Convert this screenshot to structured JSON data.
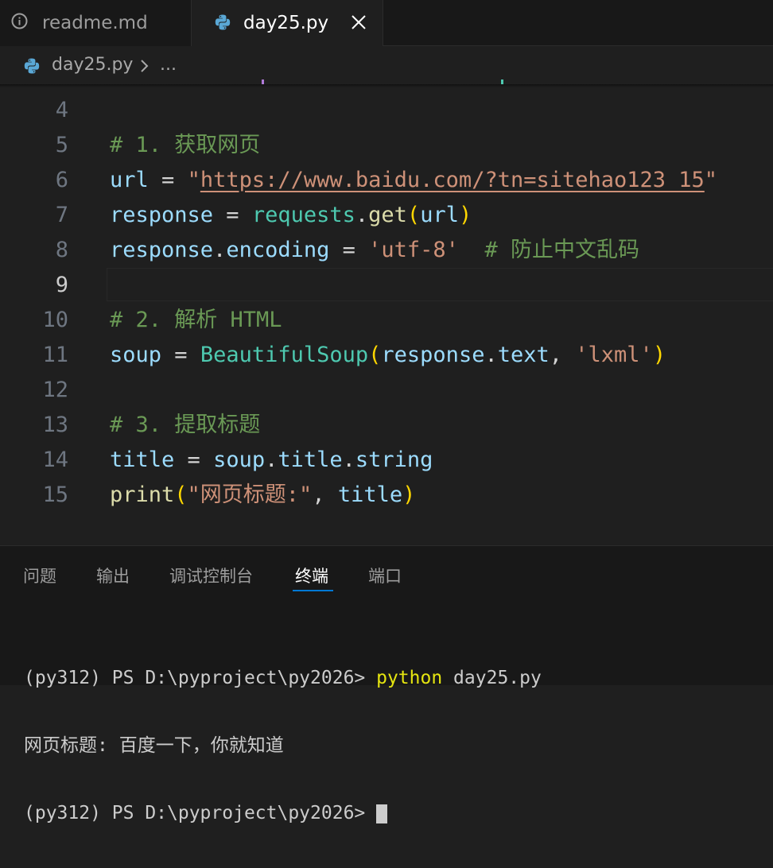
{
  "tabs": [
    {
      "label": "readme.md",
      "icon": "info-icon",
      "active": false
    },
    {
      "label": "day25.py",
      "icon": "python-icon",
      "active": true
    }
  ],
  "breadcrumb": {
    "file": "day25.py",
    "ellipsis": "..."
  },
  "editor": {
    "current_line": 9,
    "lines": [
      {
        "num": "4",
        "text": ""
      },
      {
        "num": "5",
        "comment": "# 1. 获取网页"
      },
      {
        "num": "6",
        "var": "url",
        "op": " = ",
        "q1": "\"",
        "url": "https://www.baidu.com/?tn=sitehao123_15",
        "q2": "\""
      },
      {
        "num": "7",
        "var": "response",
        "op": " = ",
        "mod": "requests",
        "dot": ".",
        "fn": "get",
        "open": "(",
        "arg": "url",
        "close": ")"
      },
      {
        "num": "8",
        "var": "response",
        "dot": ".",
        "attr": "encoding",
        "op": " = ",
        "str": "'utf-8'",
        "comment": "  # 防止中文乱码"
      },
      {
        "num": "9",
        "text": ""
      },
      {
        "num": "10",
        "comment": "# 2. 解析 HTML"
      },
      {
        "num": "11",
        "var": "soup",
        "op": " = ",
        "cls": "BeautifulSoup",
        "open": "(",
        "arg": "response",
        "dot": ".",
        "attr": "text",
        "sep": ", ",
        "str": "'lxml'",
        "close": ")"
      },
      {
        "num": "12",
        "text": ""
      },
      {
        "num": "13",
        "comment": "# 3. 提取标题"
      },
      {
        "num": "14",
        "var": "title",
        "op": " = ",
        "obj": "soup",
        "dot1": ".",
        "attr1": "title",
        "dot2": ".",
        "attr2": "string"
      },
      {
        "num": "15",
        "fn": "print",
        "open": "(",
        "str": "\"网页标题:\"",
        "sep": ", ",
        "arg": "title",
        "close": ")"
      }
    ]
  },
  "panel": {
    "tabs": [
      "问题",
      "输出",
      "调试控制台",
      "终端",
      "端口"
    ],
    "active_tab": "终端"
  },
  "terminal": {
    "prompt": "(py312) PS D:\\pyproject\\py2026> ",
    "command": "python",
    "command_arg": " day25.py",
    "output": "网页标题: 百度一下，你就知道",
    "partial_prompt": "(py312) PS D:\\pyproject\\py2026> "
  },
  "colors": {
    "background": "#1f1f1f",
    "comment": "#6a9955",
    "variable": "#9cdcfe",
    "string": "#ce9178",
    "function": "#dcdcaa",
    "class": "#4ec9b0",
    "bracket": "#ffd700",
    "accent": "#0078d4"
  }
}
